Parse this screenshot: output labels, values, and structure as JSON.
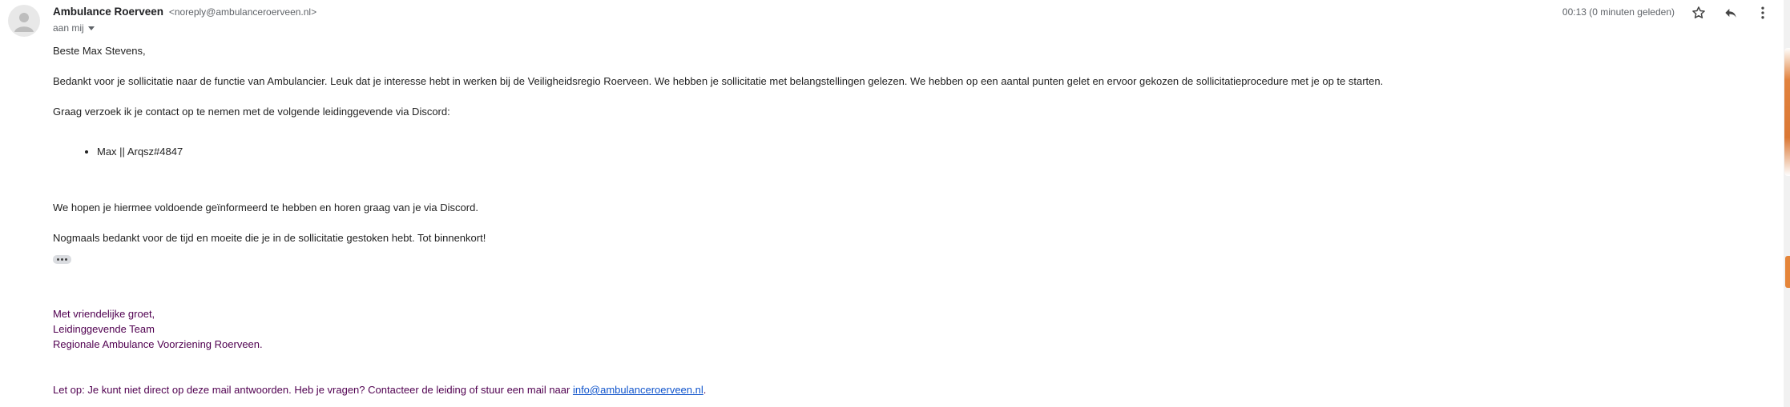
{
  "sender": {
    "name": "Ambulance Roerveen",
    "email": "<noreply@ambulanceroerveen.nl>"
  },
  "recipient": {
    "label": "aan mij"
  },
  "timestamp": "00:13 (0 minuten geleden)",
  "icons": {
    "avatar": "person-avatar-icon",
    "star": "star-outline-icon",
    "reply": "reply-arrow-icon",
    "more": "vertical-dots-icon",
    "expand": "chevron-down-icon"
  },
  "body": {
    "greeting": "Beste Max Stevens,",
    "paragraph1": "Bedankt voor je sollicitatie naar de functie van Ambulancier. Leuk dat je interesse hebt in werken bij de Veiligheidsregio Roerveen. We hebben je sollicitatie met belangstellingen gelezen. We hebben op een aantal punten gelet en ervoor gekozen de sollicitatieprocedure met je op te starten.",
    "paragraph2": "Graag verzoek ik je contact op te nemen met de volgende leidinggevende via Discord:",
    "contacts": [
      "Max || Arqsz#4847"
    ],
    "paragraph3": "We hopen je hiermee voldoende geïnformeerd te hebben en horen graag van je via Discord.",
    "paragraph4": "Nogmaals bedankt voor de tijd en moeite die je in de sollicitatie gestoken hebt. Tot binnenkort!"
  },
  "signature": {
    "line1": "Met vriendelijke groet,",
    "line2": "Leidinggevende Team",
    "line3": "Regionale Ambulance Voorziening Roerveen."
  },
  "notice": {
    "text": "Let op: Je kunt niet direct op deze mail antwoorden. Heb je vragen? Contacteer de leiding of stuur een mail naar ",
    "link": "info@ambulanceroerveen.nl",
    "suffix": "."
  },
  "colors": {
    "signature": "#500050",
    "link": "#1155cc",
    "accent": "#e0762a"
  }
}
